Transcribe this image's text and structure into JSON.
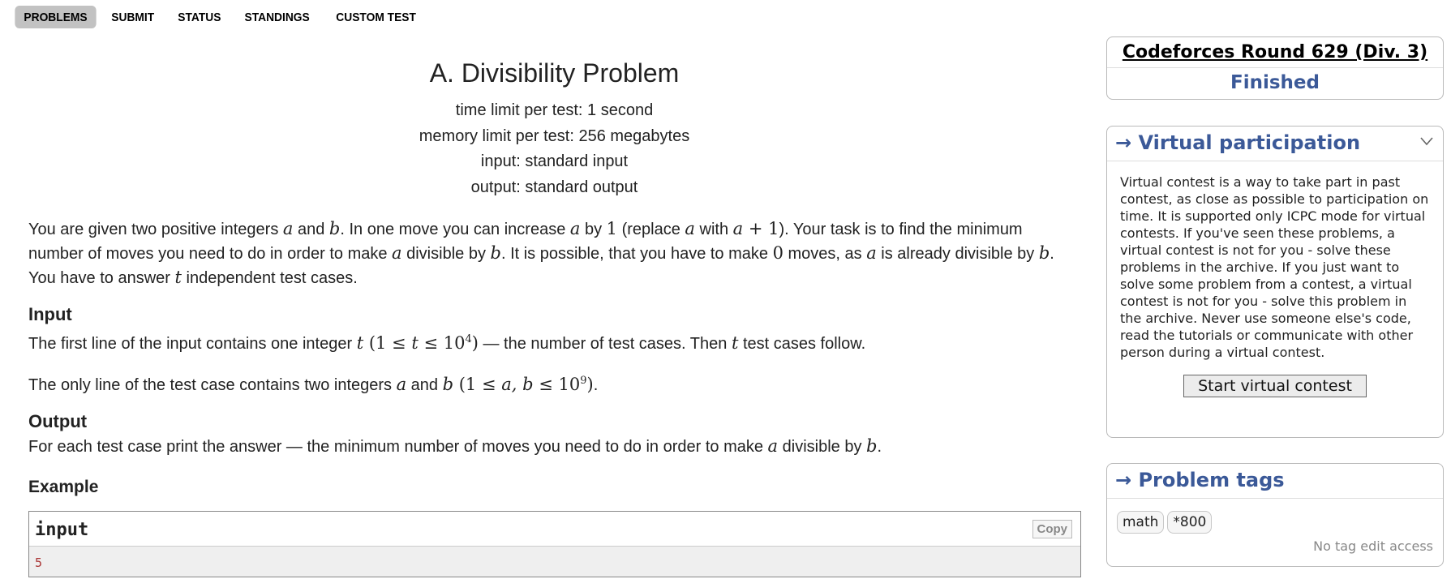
{
  "nav": {
    "items": [
      "PROBLEMS",
      "SUBMIT",
      "STATUS",
      "STANDINGS",
      "CUSTOM TEST"
    ]
  },
  "problem": {
    "title": "A. Divisibility Problem",
    "time_limit": "time limit per test: 1 second",
    "memory_limit": "memory limit per test: 256 megabytes",
    "input_file": "input: standard input",
    "output_file": "output: standard output",
    "legend": {
      "p1": "You are given two positive integers ",
      "p2": " and ",
      "p3": ". In one move you can increase ",
      "p4": " by ",
      "p5": " (replace ",
      "p6": " with ",
      "p7": "). Your task is to find the minimum number of moves you need to do in order to make ",
      "p8": " divisible by ",
      "p9": ". It is possible, that you have to make ",
      "p10": " moves, as ",
      "p11": " is already divisible by ",
      "p12": ". You have to answer ",
      "p13": " independent test cases."
    },
    "input_section_title": "Input",
    "input_text1": {
      "a": "The first line of the input contains one integer ",
      "b": " — the number of test cases. Then ",
      "c": " test cases follow."
    },
    "input_text2": {
      "a": "The only line of the test case contains two integers ",
      "b": " and ",
      "c": "."
    },
    "output_section_title": "Output",
    "output_text": {
      "a": "For each test case print the answer — the minimum number of moves you need to do in order to make ",
      "b": " divisible by ",
      "c": "."
    },
    "example_title": "Example",
    "example_input_title": "input",
    "copy_label": "Copy",
    "example_input_first_line": "5"
  },
  "sidebar": {
    "contest_name": "Codeforces Round 629 (Div. 3)",
    "contest_state": "Finished",
    "virtual_title": "→ Virtual participation",
    "virtual_text": "Virtual contest is a way to take part in past contest, as close as possible to participation on time. It is supported only ICPC mode for virtual contests. If you've seen these problems, a virtual contest is not for you - solve these problems in the archive. If you just want to solve some problem from a contest, a virtual contest is not for you - solve this problem in the archive. Never use someone else's code, read the tutorials or communicate with other person during a virtual contest.",
    "virtual_button": "Start virtual contest",
    "tags_title": "→ Problem tags",
    "tags": [
      "math",
      "*800"
    ],
    "tags_note": "No tag edit access"
  },
  "colors": {
    "accent": "#3b5998",
    "nav_active_bg": "#c2c2c2"
  }
}
